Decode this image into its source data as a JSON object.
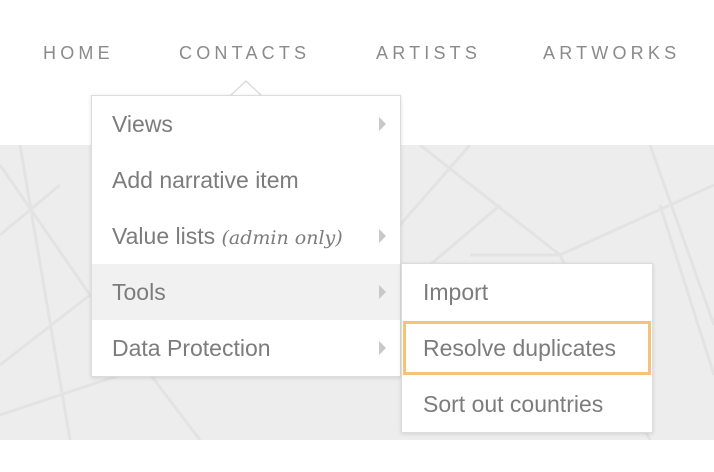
{
  "nav": {
    "items": [
      "HOME",
      "CONTACTS",
      "ARTISTS",
      "ARTWORKS"
    ]
  },
  "menu": {
    "items": [
      {
        "label": "Views",
        "has_submenu": true
      },
      {
        "label": "Add narrative item",
        "has_submenu": false
      },
      {
        "label": "Value lists",
        "note": "(admin only)",
        "has_submenu": true
      },
      {
        "label": "Tools",
        "has_submenu": true,
        "active": true
      },
      {
        "label": "Data Protection",
        "has_submenu": true
      }
    ]
  },
  "submenu": {
    "items": [
      {
        "label": "Import"
      },
      {
        "label": "Resolve duplicates",
        "highlighted": true
      },
      {
        "label": "Sort out countries"
      }
    ]
  },
  "colors": {
    "highlight_outline": "#f6c277",
    "active_item_bg": "#f1f1f1",
    "band_bg": "#ededed"
  }
}
